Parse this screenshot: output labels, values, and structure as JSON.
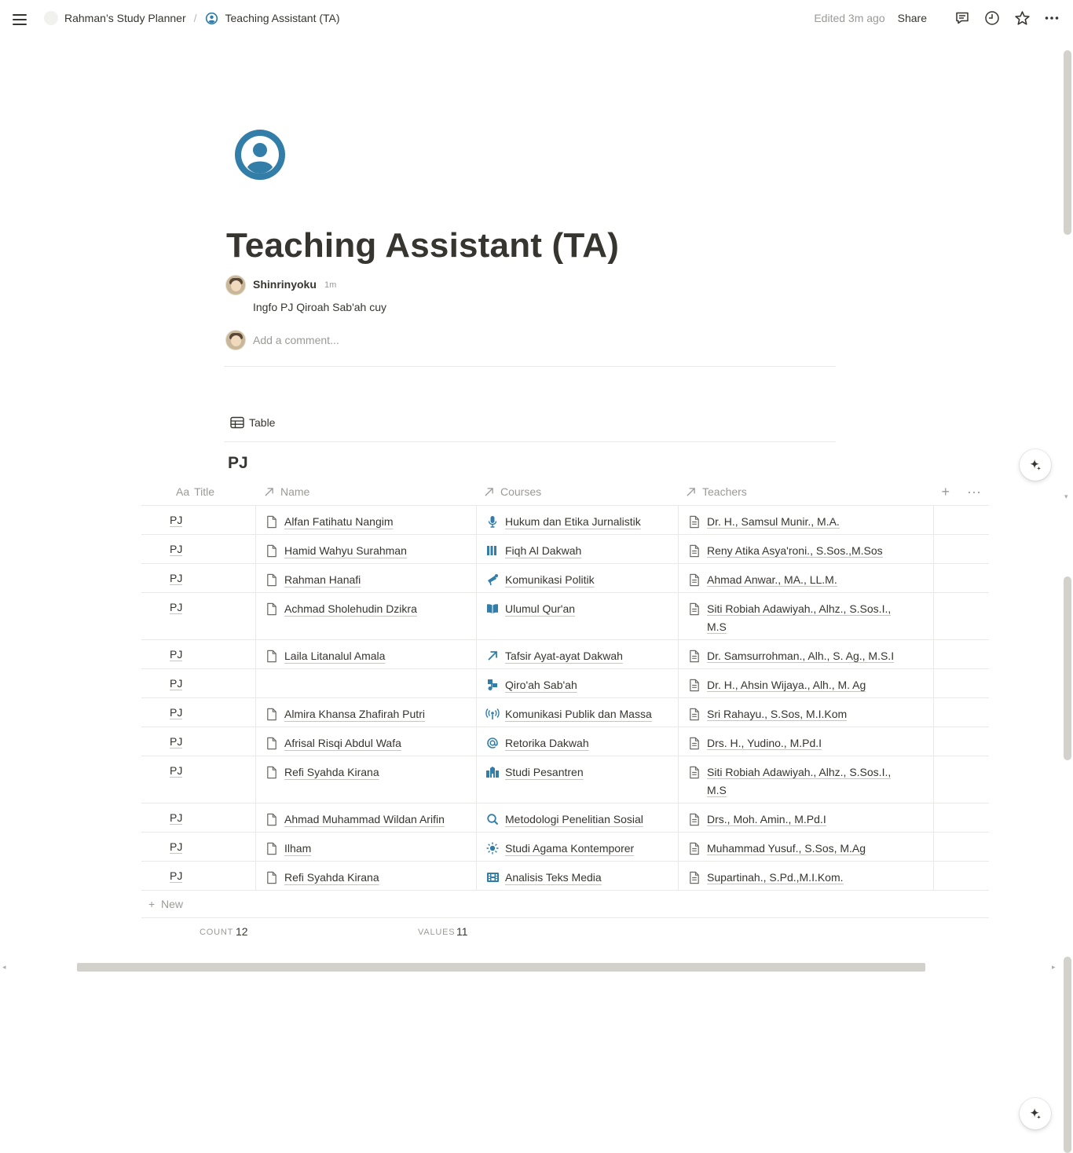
{
  "breadcrumb": {
    "workspace": "Rahman’s Study Planner",
    "separator": "/",
    "page": "Teaching Assistant (TA)"
  },
  "topbar": {
    "edited": "Edited 3m ago",
    "share": "Share"
  },
  "page": {
    "title": "Teaching Assistant (TA)",
    "icon": "user-circle-icon",
    "accent_color": "#337ea9"
  },
  "comment": {
    "author": "Shinrinyoku",
    "time": "1m",
    "text": "Ingfo PJ Qiroah Sab'ah cuy",
    "add_placeholder": "Add a comment..."
  },
  "database": {
    "view_tab": "Table",
    "title": "PJ",
    "columns": {
      "title": "Title",
      "title_prefix": "Aa",
      "name": "Name",
      "courses": "Courses",
      "teachers": "Teachers"
    },
    "rows": [
      {
        "title": "PJ",
        "name": "Alfan Fatihatu Nangim",
        "course": "Hukum dan Etika Jurnalistik",
        "course_icon": "microphone-icon",
        "teacher": [
          "Dr. H., Samsul Munir., M.A."
        ]
      },
      {
        "title": "PJ",
        "name": "Hamid Wahyu Surahman",
        "course": "Fiqh Al Dakwah",
        "course_icon": "books-icon",
        "teacher": [
          "Reny Atika Asya'roni., S.Sos.,M.Sos"
        ]
      },
      {
        "title": "PJ",
        "name": "Rahman Hanafi",
        "course": "Komunikasi Politik",
        "course_icon": "megaphone-icon",
        "teacher": [
          "Ahmad Anwar., MA., LL.M."
        ]
      },
      {
        "title": "PJ",
        "name": "Achmad Sholehudin Dzikra",
        "course": "Ulumul Qur'an",
        "course_icon": "open-book-icon",
        "teacher": [
          "Siti Robiah Adawiyah., Alhz., S.Sos.I.,",
          "M.S"
        ]
      },
      {
        "title": "PJ",
        "name": "Laila Litanalul Amala",
        "course": "Tafsir Ayat-ayat Dakwah",
        "course_icon": "arrow-up-right-icon",
        "teacher": [
          "Dr. Samsurrohman., Alh., S. Ag., M.S.I"
        ]
      },
      {
        "title": "PJ",
        "name": "",
        "course": "Qiro'ah Sab'ah",
        "course_icon": "music-notes-icon",
        "teacher": [
          "Dr. H., Ahsin Wijaya., Alh., M. Ag"
        ]
      },
      {
        "title": "PJ",
        "name": "Almira Khansa Zhafirah Putri",
        "course": "Komunikasi Publik dan Massa",
        "course_icon": "broadcast-icon",
        "teacher": [
          "Sri Rahayu., S.Sos, M.I.Kom"
        ]
      },
      {
        "title": "PJ",
        "name": "Afrisal Risqi Abdul Wafa",
        "course": "Retorika Dakwah",
        "course_icon": "at-sign-icon",
        "teacher": [
          "Drs. H., Yudino., M.Pd.I"
        ]
      },
      {
        "title": "PJ",
        "name": "Refi Syahda Kirana",
        "course": "Studi Pesantren",
        "course_icon": "building-icon",
        "teacher": [
          "Siti Robiah Adawiyah., Alhz., S.Sos.I.,",
          "M.S"
        ]
      },
      {
        "title": "PJ",
        "name": "Ahmad Muhammad Wildan Arifin",
        "course": "Metodologi Penelitian Sosial",
        "course_icon": "search-icon",
        "teacher": [
          "Drs., Moh. Amin., M.Pd.I"
        ]
      },
      {
        "title": "PJ",
        "name": "Ilham",
        "course": "Studi Agama Kontemporer",
        "course_icon": "sun-icon",
        "teacher": [
          "Muhammad Yusuf., S.Sos, M.Ag"
        ]
      },
      {
        "title": "PJ",
        "name": "Refi Syahda Kirana",
        "course": "Analisis Teks Media",
        "course_icon": "film-icon",
        "teacher": [
          "Supartinah., S.Pd.,M.I.Kom."
        ]
      }
    ],
    "new_label": "New",
    "calc": {
      "count_label": "COUNT",
      "count_value": "12",
      "values_label": "VALUES",
      "values_value": "11"
    }
  }
}
